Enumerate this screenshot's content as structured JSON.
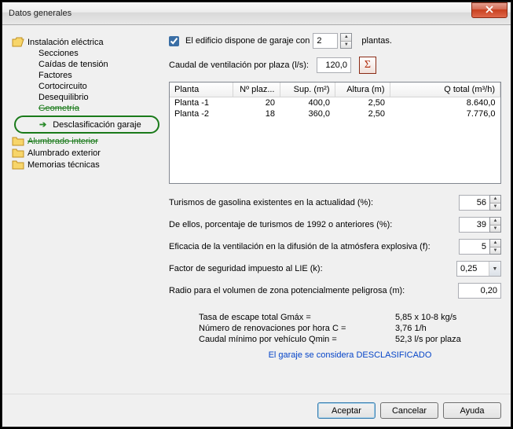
{
  "window": {
    "title": "Datos generales"
  },
  "tree": {
    "root": "Instalación eléctrica",
    "children": [
      "Secciones",
      "Caídas de tensión",
      "Factores",
      "Cortocircuito",
      "Desequilibrio",
      "Geometría",
      "Desclasificación garaje"
    ],
    "folders": [
      "Alumbrado interior",
      "Alumbrado exterior",
      "Memorias técnicas"
    ]
  },
  "garage": {
    "checkbox_label_pre": "El edificio dispone de garaje con",
    "checkbox_label_post": "plantas.",
    "plantas": "2",
    "caudal_label": "Caudal de ventilación por plaza (l/s):",
    "caudal_value": "120,0"
  },
  "table": {
    "headers": [
      "Planta",
      "Nº plaz...",
      "Sup. (m²)",
      "Altura (m)",
      "Q total (m³/h)"
    ],
    "rows": [
      {
        "planta": "Planta -1",
        "plazas": "20",
        "sup": "400,0",
        "alt": "2,50",
        "q": "8.640,0"
      },
      {
        "planta": "Planta -2",
        "plazas": "18",
        "sup": "360,0",
        "alt": "2,50",
        "q": "7.776,0"
      }
    ]
  },
  "params": {
    "p1": {
      "label": "Turismos de gasolina existentes en la actualidad (%):",
      "value": "56"
    },
    "p2": {
      "label": "De ellos, porcentaje de turismos de 1992 o anteriores (%):",
      "value": "39"
    },
    "p3": {
      "label": "Eficacia de la ventilación en la difusión de la atmósfera explosiva (f):",
      "value": "5"
    },
    "p4": {
      "label": "Factor de seguridad impuesto al LIE (k):",
      "value": "0,25"
    },
    "p5": {
      "label": "Radio para el volumen de zona potencialmente peligrosa (m):",
      "value": "0,20"
    }
  },
  "results": {
    "r1": {
      "label": "Tasa de escape total Gmáx =",
      "value": "5,85 x 10-8 kg/s"
    },
    "r2": {
      "label": "Número de renovaciones por hora C =",
      "value": "3,76 1/h"
    },
    "r3": {
      "label": "Caudal mínimo por vehículo Qmin =",
      "value": "52,3 l/s por plaza"
    },
    "classified": "El garaje se considera DESCLASIFICADO"
  },
  "buttons": {
    "ok": "Aceptar",
    "cancel": "Cancelar",
    "help": "Ayuda"
  }
}
